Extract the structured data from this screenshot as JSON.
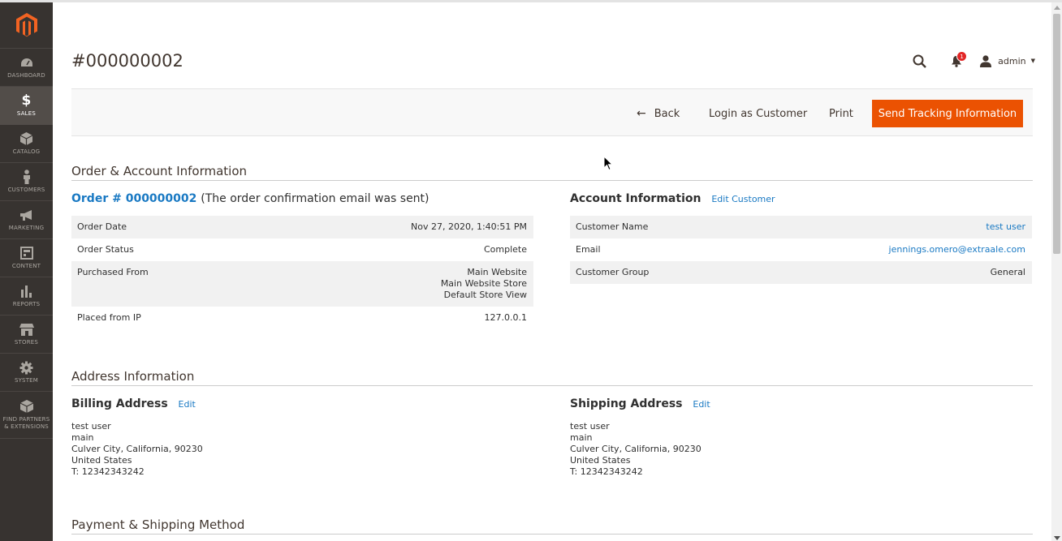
{
  "sidebar": {
    "items": [
      {
        "label": "DASHBOARD",
        "icon": "dashboard-icon"
      },
      {
        "label": "SALES",
        "icon": "dollar-icon"
      },
      {
        "label": "CATALOG",
        "icon": "box-icon"
      },
      {
        "label": "CUSTOMERS",
        "icon": "person-icon"
      },
      {
        "label": "MARKETING",
        "icon": "megaphone-icon"
      },
      {
        "label": "CONTENT",
        "icon": "content-icon"
      },
      {
        "label": "REPORTS",
        "icon": "bar-chart-icon"
      },
      {
        "label": "STORES",
        "icon": "store-icon"
      },
      {
        "label": "SYSTEM",
        "icon": "gear-icon"
      },
      {
        "label_line1": "FIND PARTNERS",
        "label_line2": "& EXTENSIONS",
        "icon": "partners-icon"
      }
    ],
    "active": "SALES"
  },
  "header": {
    "title": "#000000002",
    "notifications_count": "1",
    "user": "admin"
  },
  "actions": {
    "back": "Back",
    "login_as_customer": "Login as Customer",
    "print": "Print",
    "send_tracking": "Send Tracking Information"
  },
  "order_account": {
    "section_title": "Order & Account Information",
    "order_link": "Order # 000000002",
    "order_note": "(The order confirmation email was sent)",
    "order_rows": [
      {
        "label": "Order Date",
        "value": "Nov 27, 2020, 1:40:51 PM"
      },
      {
        "label": "Order Status",
        "value": "Complete"
      },
      {
        "label": "Purchased From",
        "value_lines": [
          "Main Website",
          "Main Website Store",
          "Default Store View"
        ]
      },
      {
        "label": "Placed from IP",
        "value": "127.0.0.1"
      }
    ],
    "account_title": "Account Information",
    "edit_customer": "Edit Customer",
    "account_rows": [
      {
        "label": "Customer Name",
        "value": "test user"
      },
      {
        "label": "Email",
        "value": "jennings.omero@extraale.com"
      },
      {
        "label": "Customer Group",
        "value": "General"
      }
    ]
  },
  "address": {
    "section_title": "Address Information",
    "billing_title": "Billing Address",
    "shipping_title": "Shipping Address",
    "edit": "Edit",
    "billing_lines": [
      "test user",
      "main",
      "Culver City, California, 90230",
      "United States",
      "T: 12342343242"
    ],
    "shipping_lines": [
      "test user",
      "main",
      "Culver City, California, 90230",
      "United States",
      "T: 12342343242"
    ]
  },
  "payment": {
    "section_title": "Payment & Shipping Method"
  },
  "colors": {
    "sidebar_bg": "#373330",
    "accent": "#eb5202",
    "link": "#1979c3",
    "badge": "#e22626"
  }
}
